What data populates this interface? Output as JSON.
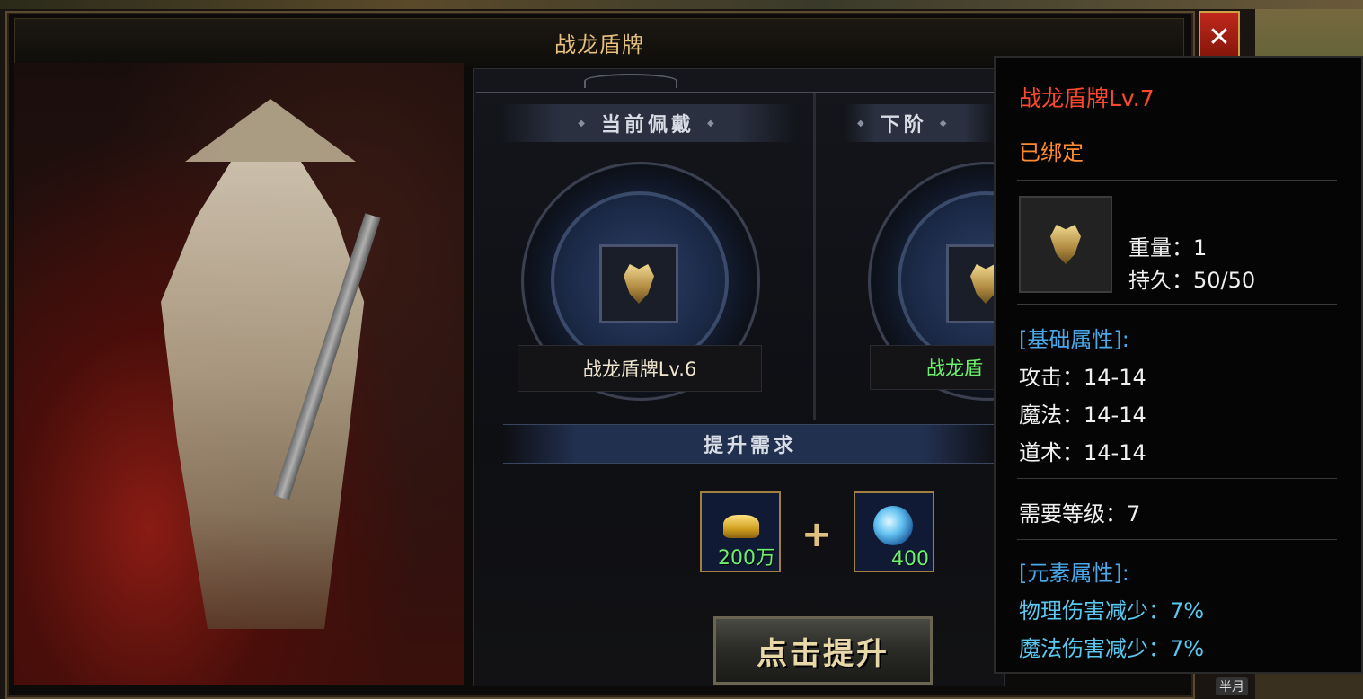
{
  "dialog": {
    "title": "战龙盾牌",
    "close_label": "✕"
  },
  "current": {
    "header": "当前佩戴",
    "item_name": "战龙盾牌Lv.6"
  },
  "next": {
    "header": "下阶",
    "item_name": "战龙盾"
  },
  "requirements": {
    "header": "提升需求",
    "materials": [
      {
        "name": "gold-ingot",
        "count": "200万"
      },
      {
        "name": "spirit-orb",
        "count": "400"
      }
    ],
    "plus": "+"
  },
  "upgrade_button": "点击提升",
  "tooltip": {
    "title": "战龙盾牌Lv.7",
    "bound": "已绑定",
    "weight": "重量：1",
    "durability": "持久：50/50",
    "base_header": "[基础属性]:",
    "attack": "攻击：14-14",
    "magic": "魔法：14-14",
    "taoism": "道术：14-14",
    "level_req": "需要等级：7",
    "element_header": "[元素属性]:",
    "phys_reduce": "物理伤害减少：7%",
    "magic_reduce": "魔法伤害减少：7%"
  },
  "hud": {
    "moon_label": "半月"
  },
  "colors": {
    "title_gold": "#e8c080",
    "tooltip_red": "#ff4830",
    "tooltip_orange": "#ff8c30",
    "attr_blue": "#4aa8e8",
    "element_cyan": "#5ac8f0",
    "next_green": "#6cf06c"
  }
}
